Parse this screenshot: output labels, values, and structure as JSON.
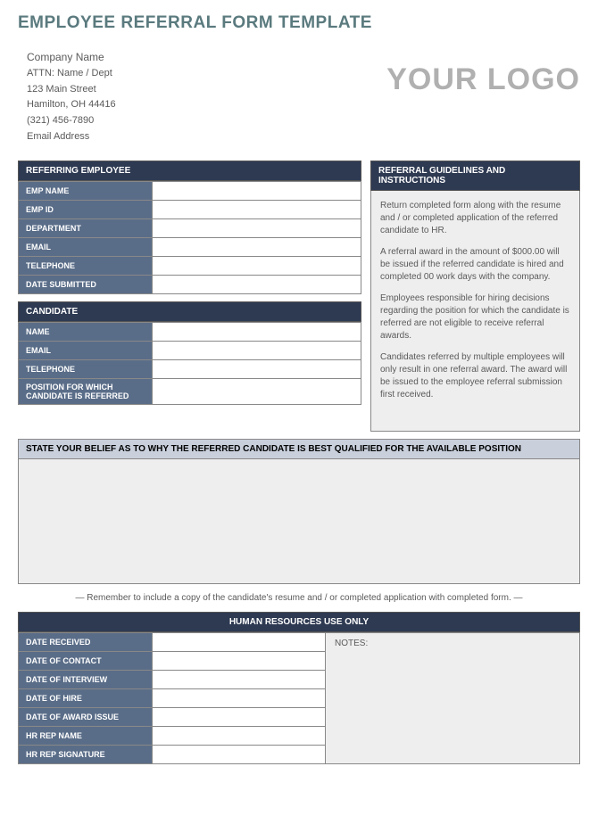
{
  "title": "EMPLOYEE REFERRAL FORM TEMPLATE",
  "company": {
    "name": "Company Name",
    "attn": "ATTN: Name / Dept",
    "street": "123 Main Street",
    "city": "Hamilton, OH  44416",
    "phone": "(321) 456-7890",
    "email": "Email Address"
  },
  "logo": "YOUR LOGO",
  "referring": {
    "header": "REFERRING EMPLOYEE",
    "fields": [
      {
        "label": "EMP NAME",
        "value": ""
      },
      {
        "label": "EMP ID",
        "value": ""
      },
      {
        "label": "DEPARTMENT",
        "value": ""
      },
      {
        "label": "EMAIL",
        "value": ""
      },
      {
        "label": "TELEPHONE",
        "value": ""
      },
      {
        "label": "DATE SUBMITTED",
        "value": ""
      }
    ]
  },
  "candidate": {
    "header": "CANDIDATE",
    "fields": [
      {
        "label": "NAME",
        "value": ""
      },
      {
        "label": "EMAIL",
        "value": ""
      },
      {
        "label": "TELEPHONE",
        "value": ""
      },
      {
        "label": "POSITION FOR WHICH CANDIDATE IS REFERRED",
        "value": ""
      }
    ]
  },
  "guidelines": {
    "header": "REFERRAL GUIDELINES AND INSTRUCTIONS",
    "p1": "Return completed form along with the resume and / or completed application of the referred candidate to HR.",
    "p2": "A referral award in the amount of $000.00 will be issued if the referred candidate is hired and completed 00 work days with the company.",
    "p3": "Employees responsible for hiring decisions regarding the position for which the candidate is referred are not eligible to receive referral awards.",
    "p4": "Candidates referred by multiple employees will only result in one referral award.  The award will be issued to the employee referral submission first received."
  },
  "belief": {
    "header": "STATE YOUR BELIEF AS TO WHY THE REFERRED CANDIDATE IS BEST QUALIFIED FOR THE AVAILABLE POSITION"
  },
  "reminder": "— Remember to include a copy of the candidate's resume and / or completed application with completed form. —",
  "hr": {
    "header": "HUMAN RESOURCES USE ONLY",
    "fields": [
      {
        "label": "DATE RECEIVED",
        "value": ""
      },
      {
        "label": "DATE OF CONTACT",
        "value": ""
      },
      {
        "label": "DATE OF INTERVIEW",
        "value": ""
      },
      {
        "label": "DATE OF HIRE",
        "value": ""
      },
      {
        "label": "DATE OF AWARD ISSUE",
        "value": ""
      },
      {
        "label": "HR REP NAME",
        "value": ""
      },
      {
        "label": "HR REP SIGNATURE",
        "value": ""
      }
    ],
    "notes_label": "NOTES:"
  }
}
